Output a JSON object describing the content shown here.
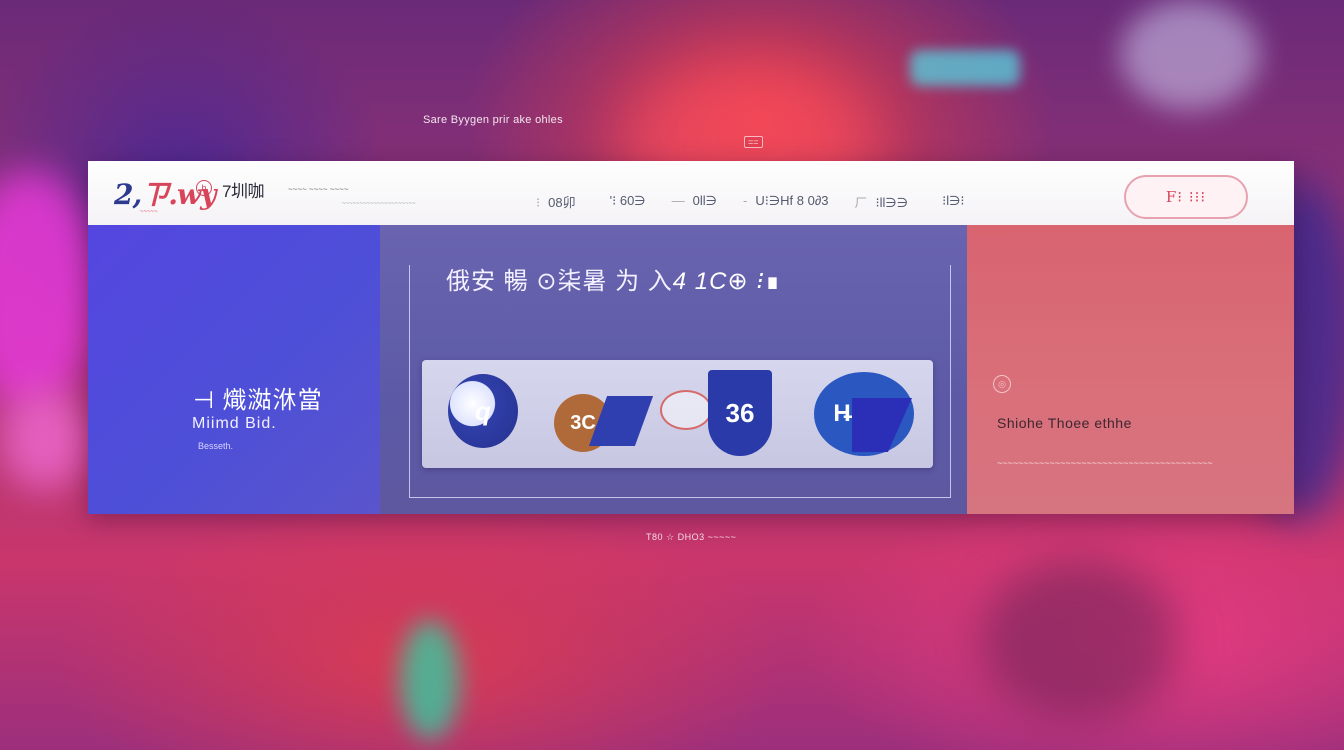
{
  "page": {
    "top_caption": "Sare Byygen prir ake ohles",
    "top_badge": "==",
    "bottom_caption": "T80 ☆ DHO3 ~~~~~"
  },
  "header": {
    "logo_text": "2,",
    "logo_accent": "ㄗ.wy",
    "logo_sub": "~~~~~",
    "logo_circle": "b",
    "brand_name": "7圳咖",
    "brand_tag": "~~~~ ~~~~ ~~~~",
    "brand_line": "~~~~~~~~~~~~~~~~~~~~~",
    "nav_items": [
      {
        "sep": "⁝",
        "label": "08卯"
      },
      {
        "sep": "",
        "label": "'⁝ 60∋"
      },
      {
        "sep": "—",
        "label": "0ll∋"
      },
      {
        "sep": "-",
        "label": "U⁝∋Hf 8 0∂3"
      },
      {
        "sep": "ㄏ",
        "label": "⁝ll∋∋"
      },
      {
        "sep": "",
        "label": "⁝l∋⁝"
      }
    ],
    "cta_label": "F⁝ ⁝⁝⁝"
  },
  "left_panel": {
    "title": "⊣ 熾㵈㳜當",
    "subtitle": "Miimd Bid.",
    "small": "Besseth."
  },
  "middle_panel": {
    "title": "俄安 暢 ⊙柒暑 为 入",
    "title_accent": "4 1C⊕ ⁝∎",
    "logos": [
      {
        "name": "q",
        "text": "q"
      },
      {
        "name": "3c",
        "text": "3C"
      },
      {
        "name": "badge",
        "text": ""
      },
      {
        "name": "36",
        "text": "36"
      },
      {
        "name": "hk-8l",
        "text": "H̶K 8l"
      }
    ]
  },
  "right_panel": {
    "icon_text": "◎",
    "title": "Shiohe  Thoee ethhe",
    "desc": "~~~~~~~~~~~~~~~~~~~~~~~~~~~~~~~~~~~~~~~~~"
  }
}
